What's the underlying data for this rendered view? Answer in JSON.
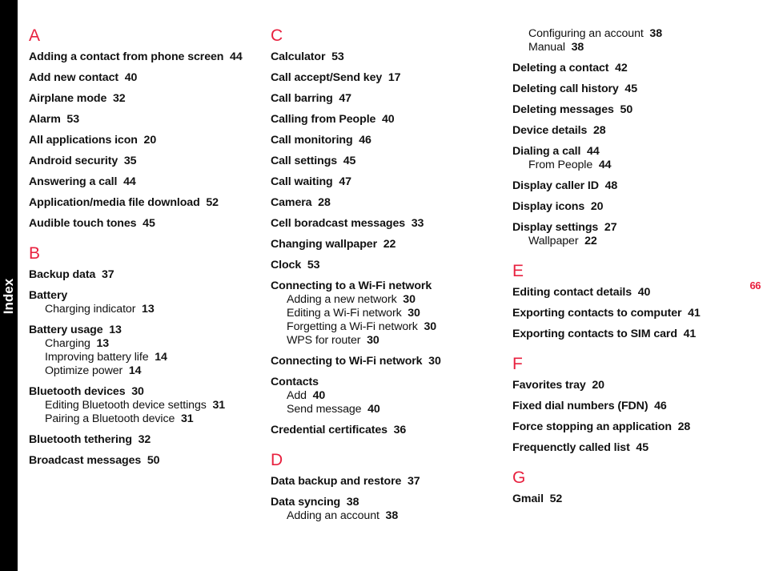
{
  "page": {
    "number": "66",
    "tab_label": "Index",
    "accent_color": "#E8213F",
    "text_color": "#111111",
    "tab_background": "#000000",
    "background": "#ffffff"
  },
  "columns": [
    {
      "sections": [
        {
          "letter": "A",
          "entries": [
            {
              "title": "Adding a contact from phone screen",
              "page": "44",
              "subentries": []
            },
            {
              "title": "Add new contact",
              "page": "40",
              "subentries": []
            },
            {
              "title": "Airplane mode",
              "page": "32",
              "subentries": []
            },
            {
              "title": "Alarm",
              "page": "53",
              "subentries": []
            },
            {
              "title": "All applications icon",
              "page": "20",
              "subentries": []
            },
            {
              "title": "Android security",
              "page": "35",
              "subentries": []
            },
            {
              "title": "Answering a call",
              "page": "44",
              "subentries": []
            },
            {
              "title": "Application/media file download",
              "page": "52",
              "subentries": []
            },
            {
              "title": "Audible touch tones",
              "page": "45",
              "subentries": []
            }
          ]
        },
        {
          "letter": "B",
          "entries": [
            {
              "title": "Backup data",
              "page": "37",
              "subentries": []
            },
            {
              "title": "Battery",
              "page": "",
              "subentries": [
                {
                  "title": "Charging indicator",
                  "page": "13"
                }
              ]
            },
            {
              "title": "Battery usage",
              "page": "13",
              "subentries": [
                {
                  "title": "Charging",
                  "page": "13"
                },
                {
                  "title": "Improving battery life",
                  "page": "14"
                },
                {
                  "title": "Optimize power",
                  "page": "14"
                }
              ]
            },
            {
              "title": "Bluetooth devices",
              "page": "30",
              "subentries": [
                {
                  "title": "Editing Bluetooth device settings",
                  "page": "31"
                },
                {
                  "title": "Pairing a Bluetooth device",
                  "page": "31"
                }
              ]
            },
            {
              "title": "Bluetooth tethering",
              "page": "32",
              "subentries": []
            },
            {
              "title": "Broadcast messages",
              "page": "50",
              "subentries": []
            }
          ]
        }
      ]
    },
    {
      "sections": [
        {
          "letter": "C",
          "entries": [
            {
              "title": "Calculator",
              "page": "53",
              "subentries": []
            },
            {
              "title": "Call accept/Send key",
              "page": "17",
              "subentries": []
            },
            {
              "title": "Call barring",
              "page": "47",
              "subentries": []
            },
            {
              "title": "Calling from People",
              "page": "40",
              "subentries": []
            },
            {
              "title": "Call monitoring",
              "page": "46",
              "subentries": []
            },
            {
              "title": "Call settings",
              "page": "45",
              "subentries": []
            },
            {
              "title": "Call waiting",
              "page": "47",
              "subentries": []
            },
            {
              "title": "Camera",
              "page": "28",
              "subentries": []
            },
            {
              "title": "Cell boradcast messages",
              "page": "33",
              "subentries": []
            },
            {
              "title": "Changing wallpaper",
              "page": "22",
              "subentries": []
            },
            {
              "title": "Clock",
              "page": "53",
              "subentries": []
            },
            {
              "title": "Connecting to a Wi-Fi network",
              "page": "",
              "subentries": [
                {
                  "title": "Adding a new network",
                  "page": "30"
                },
                {
                  "title": "Editing a Wi-Fi network",
                  "page": "30"
                },
                {
                  "title": "Forgetting a Wi-Fi network",
                  "page": "30"
                },
                {
                  "title": "WPS for router",
                  "page": "30"
                }
              ]
            },
            {
              "title": "Connecting to Wi-Fi network",
              "page": "30",
              "subentries": []
            },
            {
              "title": "Contacts",
              "page": "",
              "subentries": [
                {
                  "title": "Add",
                  "page": "40"
                },
                {
                  "title": "Send message",
                  "page": "40"
                }
              ]
            },
            {
              "title": "Credential certificates",
              "page": "36",
              "subentries": []
            }
          ]
        },
        {
          "letter": "D",
          "entries": [
            {
              "title": "Data backup and restore",
              "page": "37",
              "subentries": []
            },
            {
              "title": "Data syncing",
              "page": "38",
              "subentries": [
                {
                  "title": "Adding an account",
                  "page": "38"
                }
              ]
            }
          ]
        }
      ]
    },
    {
      "sections": [
        {
          "letter": "",
          "entries": [
            {
              "title": "",
              "page": "",
              "subentries": [
                {
                  "title": "Configuring an account",
                  "page": "38"
                },
                {
                  "title": "Manual",
                  "page": "38"
                }
              ]
            },
            {
              "title": "Deleting a contact",
              "page": "42",
              "subentries": []
            },
            {
              "title": "Deleting call history",
              "page": "45",
              "subentries": []
            },
            {
              "title": "Deleting messages",
              "page": "50",
              "subentries": []
            },
            {
              "title": "Device details",
              "page": "28",
              "subentries": []
            },
            {
              "title": "Dialing a call",
              "page": "44",
              "subentries": [
                {
                  "title": "From People",
                  "page": "44"
                }
              ]
            },
            {
              "title": "Display caller ID",
              "page": "48",
              "subentries": []
            },
            {
              "title": "Display icons",
              "page": "20",
              "subentries": []
            },
            {
              "title": "Display settings",
              "page": "27",
              "subentries": [
                {
                  "title": "Wallpaper",
                  "page": "22"
                }
              ]
            }
          ]
        },
        {
          "letter": "E",
          "entries": [
            {
              "title": "Editing contact details",
              "page": "40",
              "subentries": []
            },
            {
              "title": "Exporting contacts to computer",
              "page": "41",
              "subentries": []
            },
            {
              "title": "Exporting contacts to SIM card",
              "page": "41",
              "subentries": []
            }
          ]
        },
        {
          "letter": "F",
          "entries": [
            {
              "title": "Favorites tray",
              "page": "20",
              "subentries": []
            },
            {
              "title": "Fixed dial numbers (FDN)",
              "page": "46",
              "subentries": []
            },
            {
              "title": "Force stopping an application",
              "page": "28",
              "subentries": []
            },
            {
              "title": "Frequenctly called list",
              "page": "45",
              "subentries": []
            }
          ]
        },
        {
          "letter": "G",
          "entries": [
            {
              "title": "Gmail",
              "page": "52",
              "subentries": []
            }
          ]
        }
      ]
    }
  ]
}
